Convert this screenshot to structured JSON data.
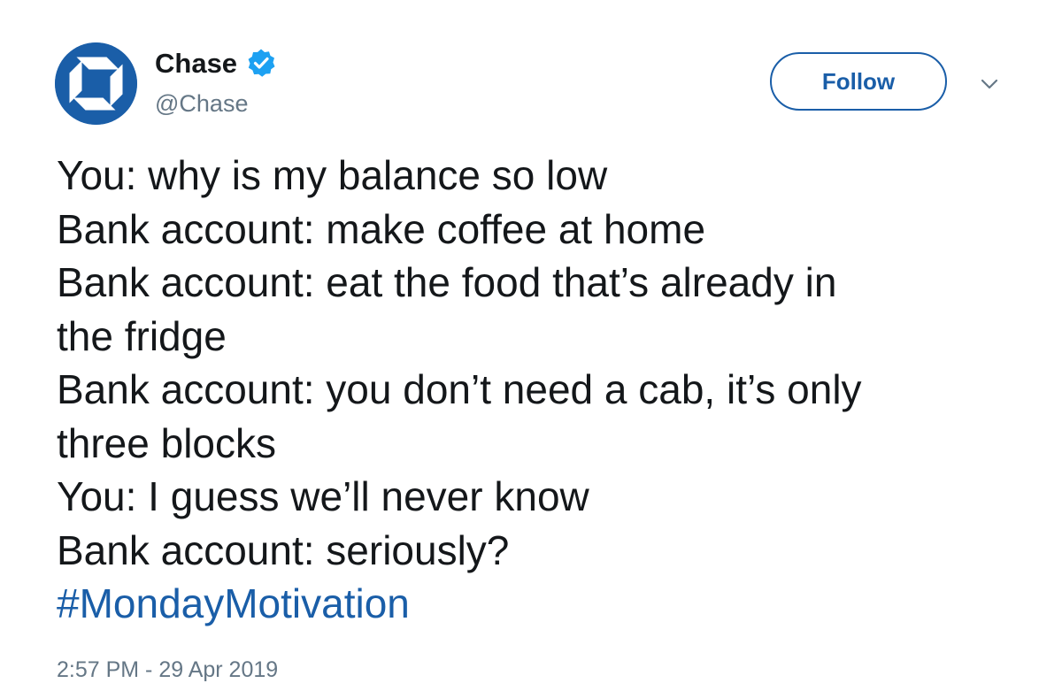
{
  "author": {
    "display_name": "Chase",
    "handle": "@Chase",
    "verified": true,
    "avatar_icon": "chase-octagon-logo",
    "brand_color": "#1a5ea8"
  },
  "actions": {
    "follow_label": "Follow",
    "menu_icon": "chevron-down-icon"
  },
  "tweet": {
    "lines": [
      "You: why is my balance so low",
      "Bank account: make coffee at home",
      "Bank account: eat the food that’s already in",
      "the fridge",
      "Bank account: you don’t need a cab, it’s only",
      "three blocks",
      "You: I guess we’ll never know",
      "Bank account: seriously?"
    ],
    "hashtag": "#MondayMotivation",
    "timestamp": "2:57 PM - 29 Apr 2019"
  },
  "colors": {
    "text": "#14171a",
    "muted": "#657786",
    "link": "#1a5ea8",
    "verified": "#1da1f2"
  }
}
